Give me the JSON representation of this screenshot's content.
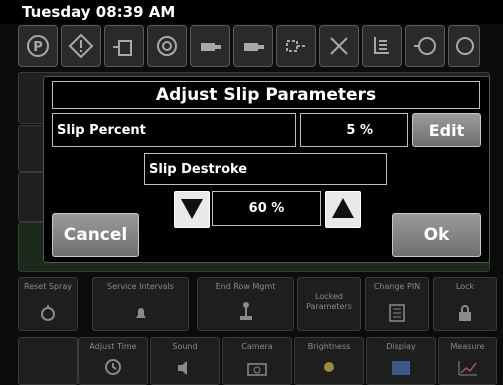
{
  "status": {
    "clock": "Tuesday 08:39 AM"
  },
  "modal": {
    "title": "Adjust Slip Parameters",
    "slip_percent_label": "Slip Percent",
    "slip_percent_value": "5 %",
    "edit_label": "Edit",
    "slip_destroke_label": "Slip Destroke",
    "slip_destroke_value": "60 %",
    "cancel_label": "Cancel",
    "ok_label": "Ok"
  },
  "tiles_row1": [
    {
      "label": "Reset Spray",
      "icon": "stopwatch-icon"
    },
    {
      "label": "Service Intervals",
      "icon": "bell-icon"
    },
    {
      "label": "End Row Mgmt",
      "icon": "joystick-icon"
    },
    {
      "label": "Locked Parameters",
      "icon": ""
    },
    {
      "label": "Change PIN",
      "icon": "keypad-icon"
    },
    {
      "label": "Lock",
      "icon": "lock-icon"
    }
  ],
  "tiles_row2": [
    {
      "label": "Adjust Time",
      "icon": "clock-icon"
    },
    {
      "label": "Sound",
      "icon": "speaker-icon"
    },
    {
      "label": "Camera",
      "icon": "camera-icon"
    },
    {
      "label": "Brightness",
      "icon": "sun-icon"
    },
    {
      "label": "Display",
      "icon": "display-icon"
    },
    {
      "label": "Measure",
      "icon": "chart-icon"
    }
  ],
  "colors": {
    "button_gray": "#8a8a8a",
    "frame": "#bdbdbd",
    "background": "#0c0c0c"
  }
}
